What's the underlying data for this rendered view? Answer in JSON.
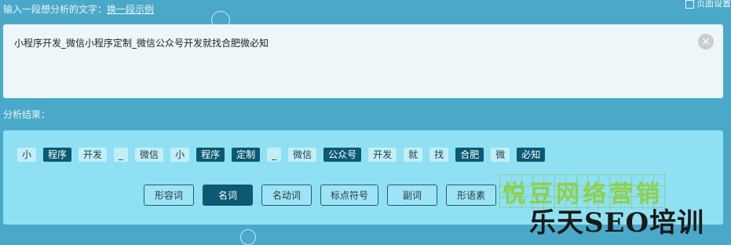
{
  "header": {
    "prompt": "输入一段想分析的文字：",
    "example_link": "换一段示例",
    "top_right_text": "页面设置"
  },
  "input": {
    "text": "小程序开发_微信小程序定制_微信公众号开发就找合肥微必知",
    "clear_glyph": "×"
  },
  "result": {
    "label": "分析结果：",
    "tokens": [
      {
        "text": "小",
        "hl": false
      },
      {
        "text": "程序",
        "hl": true
      },
      {
        "text": "开发",
        "hl": false
      },
      {
        "text": "_",
        "hl": false
      },
      {
        "text": "微信",
        "hl": false
      },
      {
        "text": "小",
        "hl": false
      },
      {
        "text": "程序",
        "hl": true
      },
      {
        "text": "定制",
        "hl": true
      },
      {
        "text": "_",
        "hl": false
      },
      {
        "text": "微信",
        "hl": false
      },
      {
        "text": "公众号",
        "hl": true
      },
      {
        "text": "开发",
        "hl": false
      },
      {
        "text": "就",
        "hl": false
      },
      {
        "text": "找",
        "hl": false
      },
      {
        "text": "合肥",
        "hl": true
      },
      {
        "text": "微",
        "hl": false
      },
      {
        "text": "必知",
        "hl": true
      }
    ],
    "pos_buttons": [
      {
        "label": "形容词",
        "active": false
      },
      {
        "label": "名词",
        "active": true
      },
      {
        "label": "名动词",
        "active": false
      },
      {
        "label": "标点符号",
        "active": false
      },
      {
        "label": "副词",
        "active": false
      },
      {
        "label": "形语素",
        "active": false
      }
    ]
  },
  "watermark": {
    "line1": "悦豆网络营销",
    "line2": "乐天SEO培训"
  },
  "colors": {
    "background": "#4aa9c9",
    "highlight": "#0b5a72",
    "result_panel": "#8fe0f3"
  }
}
